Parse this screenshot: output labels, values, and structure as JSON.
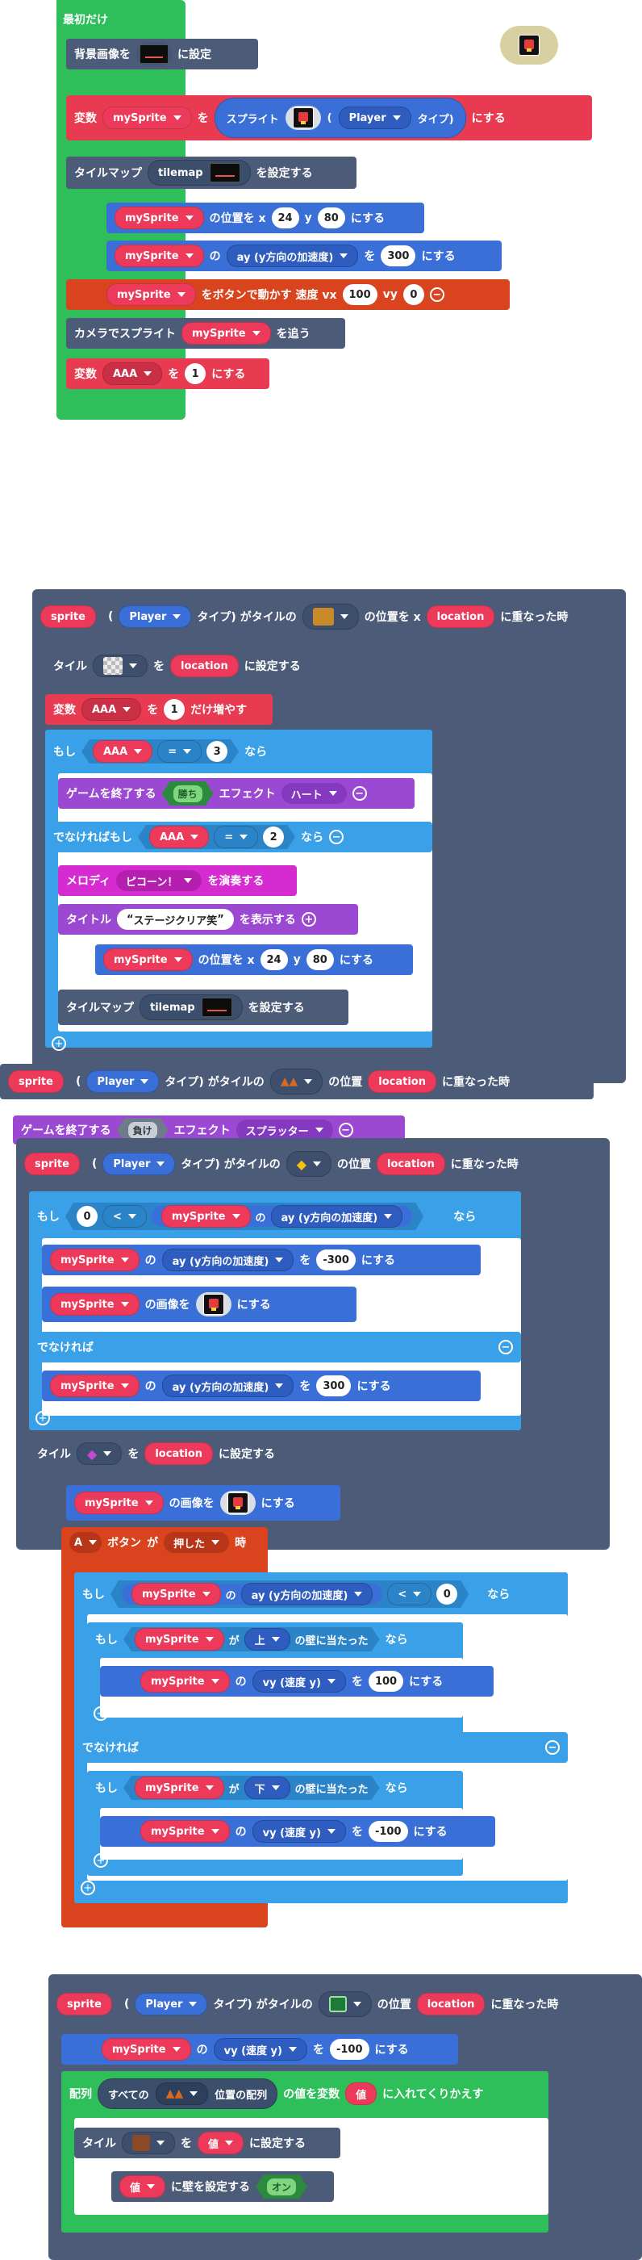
{
  "colors": {
    "event_green": "#2fbf5a",
    "scene_slate": "#4b5b78",
    "var_red": "#e83a50",
    "sprite_blue": "#3a6fd8",
    "logic_blue": "#3aa0e8",
    "purple": "#9b49d2",
    "magenta": "#d62bd1",
    "orange": "#d9431e"
  },
  "on_start": {
    "header": "最初だけ",
    "bg_label": "背景画像を",
    "bg_suffix": "に設定",
    "var_label": "変数",
    "var_name": "mySprite",
    "wo": "を",
    "sprite_label": "スプライト",
    "paren_open": "(",
    "kind": "Player",
    "type_label": "タイプ)",
    "suffix_nisuru": "にする",
    "tilemap_label": "タイルマップ",
    "tilemap_name": "tilemap",
    "tilemap_suffix": "を設定する",
    "pos_var": "mySprite",
    "pos_label": "の位置を x",
    "pos_x": "24",
    "pos_y_label": "y",
    "pos_y": "80",
    "pos_suffix": "にする",
    "prop_var": "mySprite",
    "prop_no": "の",
    "prop_name": "ay (y方向の加速度)",
    "prop_wo": "を",
    "prop_val": "300",
    "prop_suffix": "にする",
    "move_var": "mySprite",
    "move_label": "をボタンで動かす 速度 vx",
    "move_vx": "100",
    "move_vy_label": "vy",
    "move_vy": "0",
    "camera_label": "カメラでスプライト",
    "camera_var": "mySprite",
    "camera_suffix": "を追う",
    "var2_label": "変数",
    "var2_name": "AAA",
    "var2_wo": "を",
    "var2_val": "1",
    "var2_suffix": "にする"
  },
  "overlap1": {
    "sprite": "sprite",
    "paren": "(",
    "kind": "Player",
    "type_label": "タイプ) がタイルの",
    "pos_label": "の位置を x",
    "location": "location",
    "suffix": "に重なった時",
    "tile_label": "タイル",
    "tile_wo": "を",
    "tile_loc": "location",
    "tile_suffix": "に設定する",
    "inc_label": "変数",
    "inc_var": "AAA",
    "inc_wo": "を",
    "inc_val": "1",
    "inc_suffix": "だけ増やす",
    "if_label": "もし",
    "if_var": "AAA",
    "if_op": "=",
    "if_val": "3",
    "if_then": "なら",
    "gameover_label": "ゲームを終了する",
    "gameover_val": "勝ち",
    "effect_label": "エフェクト",
    "effect_val": "ハート",
    "elseif_label": "でなければもし",
    "elseif_var": "AAA",
    "elseif_op": "=",
    "elseif_val": "2",
    "elseif_then": "なら",
    "melody_label": "メロディ",
    "melody_val": "ピコーン！",
    "melody_suffix": "を演奏する",
    "title_label": "タイトル",
    "title_val": "ステージクリア笑",
    "title_suffix": "を表示する",
    "pos_var": "mySprite",
    "pos_x": "24",
    "pos_y_label": "y",
    "pos_y": "80",
    "pos_suffix": "にする",
    "tm_label": "タイルマップ",
    "tm_name": "tilemap",
    "tm_suffix": "を設定する"
  },
  "overlap2": {
    "sprite": "sprite",
    "paren": "(",
    "kind": "Player",
    "type_label": "タイプ) がタイルの",
    "pos_label": "の位置",
    "location": "location",
    "suffix": "に重なった時",
    "gameover_label": "ゲームを終了する",
    "gameover_val": "負け",
    "effect_label": "エフェクト",
    "effect_val": "スプラッター"
  },
  "overlap3": {
    "sprite": "sprite",
    "paren": "(",
    "kind": "Player",
    "type_label": "タイプ) がタイルの",
    "pos_label": "の位置",
    "location": "location",
    "suffix": "に重なった時",
    "if_label": "もし",
    "if_left": "0",
    "if_op": "<",
    "if_var": "mySprite",
    "if_no": "の",
    "if_prop": "ay (y方向の加速度)",
    "if_then": "なら",
    "set_var": "mySprite",
    "set_no": "の",
    "set_prop": "ay (y方向の加速度)",
    "set_wo": "を",
    "set_val": "-300",
    "set_suffix": "にする",
    "img_var": "mySprite",
    "img_label": "の画像を",
    "img_suffix": "にする",
    "else_label": "でなければ",
    "set2_var": "mySprite",
    "set2_no": "の",
    "set2_prop": "ay (y方向の加速度)",
    "set2_wo": "を",
    "set2_val": "300",
    "set2_suffix": "にする",
    "tile_label": "タイル",
    "tile_wo": "を",
    "tile_loc": "location",
    "tile_suffix": "に設定する",
    "img2_var": "mySprite",
    "img2_label": "の画像を",
    "img2_suffix": "にする"
  },
  "button_a": {
    "btn": "A",
    "btn_label": "ボタン",
    "ga": "が",
    "state": "押した",
    "toki": "時",
    "if_label": "もし",
    "if_var": "mySprite",
    "if_no": "の",
    "if_prop": "ay (y方向の加速度)",
    "if_op": "<",
    "if_val": "0",
    "if_then": "なら",
    "if2_label": "もし",
    "if2_var": "mySprite",
    "if2_ga": "が",
    "if2_dir": "上",
    "if2_hit": "の壁に当たった",
    "if2_then": "なら",
    "set_var": "mySprite",
    "set_no": "の",
    "set_prop": "vy (速度 y)",
    "set_wo": "を",
    "set_val": "100",
    "set_suffix": "にする",
    "else_label": "でなければ",
    "if3_label": "もし",
    "if3_var": "mySprite",
    "if3_ga": "が",
    "if3_dir": "下",
    "if3_hit": "の壁に当たった",
    "if3_then": "なら",
    "set2_var": "mySprite",
    "set2_no": "の",
    "set2_prop": "vy (速度 y)",
    "set2_wo": "を",
    "set2_val": "-100",
    "set2_suffix": "にする"
  },
  "overlap4": {
    "sprite": "sprite",
    "paren": "(",
    "kind": "Player",
    "type_label": "タイプ) がタイルの",
    "pos_label": "の位置",
    "location": "location",
    "suffix": "に重なった時",
    "set_var": "mySprite",
    "set_no": "の",
    "set_prop": "vy (速度 y)",
    "set_wo": "を",
    "set_val": "-100",
    "set_suffix": "にする",
    "arr_label": "配列",
    "arr_all": "すべての",
    "arr_pos": "位置の配列",
    "arr_rest": "の値を変数",
    "arr_var": "値",
    "arr_loop": "に入れてくりかえす",
    "tile_label": "タイル",
    "tile_wo": "を",
    "tile_val": "値",
    "tile_suffix": "に設定する",
    "wall_var": "値",
    "wall_label": "に壁を設定する",
    "wall_val": "オン"
  }
}
